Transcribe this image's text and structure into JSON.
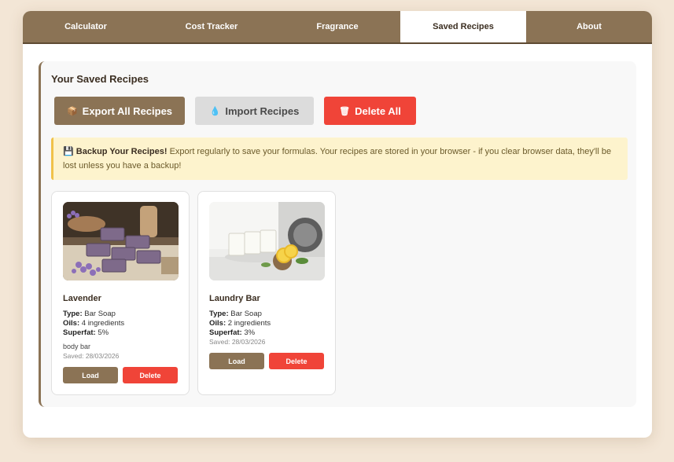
{
  "tabs": [
    "Calculator",
    "Cost Tracker",
    "Fragrance",
    "Saved Recipes",
    "About"
  ],
  "active_tab": "Saved Recipes",
  "panel": {
    "title": "Your Saved Recipes"
  },
  "actions": {
    "export_label": "Export All Recipes",
    "export_icon": "package-icon",
    "import_label": "Import Recipes",
    "import_icon": "droplet-icon",
    "delete_label": "Delete All",
    "delete_icon": "trash-icon"
  },
  "backup_alert": {
    "icon": "floppy-disk-icon",
    "title": "Backup Your Recipes!",
    "message": "Export regularly to save your formulas. Your recipes are stored in your browser - if you clear browser data, they'll be lost unless you have a backup!"
  },
  "recipes": [
    {
      "name": "Lavender",
      "type_label": "Type:",
      "type": "Bar Soap",
      "oils_label": "Oils:",
      "oils": "4 ingredients",
      "superfat_label": "Superfat:",
      "superfat": "5%",
      "notes": "body bar",
      "saved": "Saved: 28/03/2026",
      "load_label": "Load",
      "delete_label": "Delete"
    },
    {
      "name": "Laundry Bar",
      "type_label": "Type:",
      "type": "Bar Soap",
      "oils_label": "Oils:",
      "oils": "2 ingredients",
      "superfat_label": "Superfat:",
      "superfat": "3%",
      "saved": "Saved: 28/03/2026",
      "load_label": "Load",
      "delete_label": "Delete"
    }
  ],
  "colors": {
    "brand": "#8b7355",
    "danger": "#f04438",
    "alert_bg": "#fdf3cd",
    "page_bg": "#f3e6d6"
  }
}
